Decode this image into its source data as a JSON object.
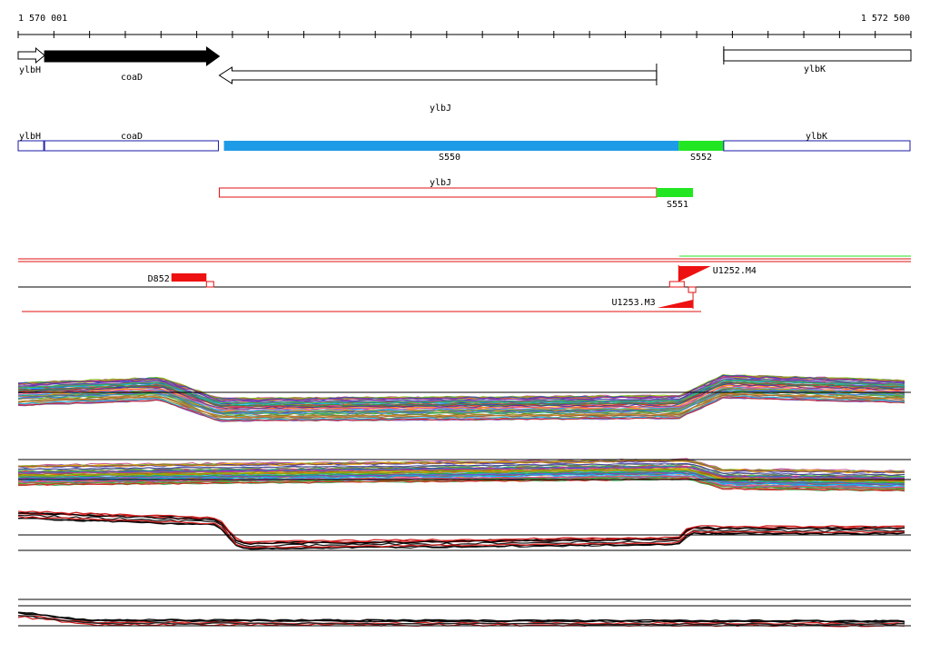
{
  "ruler": {
    "start_label": "1 570 001",
    "end_label": "1 572 500",
    "start_bp": 1570001,
    "end_bp": 1572500
  },
  "colors": {
    "segment_blue": "#1e9be6",
    "segment_green": "#22e622",
    "outline_blue": "#1a1aa6",
    "outline_red": "#e01010",
    "feature_red": "#ee1111",
    "black": "#000000"
  },
  "genes": [
    {
      "name": "ylbH",
      "start": 1570001,
      "end": 1570075,
      "strand": "+",
      "fill": "white"
    },
    {
      "name": "coaD",
      "start": 1570075,
      "end": 1570564,
      "strand": "+",
      "fill": "black"
    },
    {
      "name": "ylbJ",
      "start": 1570564,
      "end": 1571788,
      "strand": "-",
      "fill": "white"
    },
    {
      "name": "ylbK",
      "start": 1571976,
      "end": 1572500,
      "strand": "+",
      "fill": "white"
    }
  ],
  "segments": [
    {
      "label": "ylbH",
      "type": "outline",
      "start": 1570001,
      "end": 1570075
    },
    {
      "label": "coaD",
      "type": "outline",
      "start": 1570075,
      "end": 1570564
    },
    {
      "label": "S550",
      "type": "filled",
      "color": "blue",
      "start": 1570577,
      "end": 1571850
    },
    {
      "label": "S552",
      "type": "filled",
      "color": "green",
      "start": 1571850,
      "end": 1571976
    },
    {
      "label": "ylbK",
      "type": "outline",
      "start": 1571976,
      "end": 1572500
    }
  ],
  "segments2": [
    {
      "label": "ylbJ",
      "type": "outline-red",
      "start": 1570564,
      "end": 1571788
    },
    {
      "label": "S551",
      "type": "filled",
      "color": "green",
      "start": 1571788,
      "end": 1571890
    }
  ],
  "features": [
    {
      "label": "D852",
      "start": 1570430,
      "end": 1570528,
      "kind": "block"
    },
    {
      "label": "U1252.M4",
      "start": 1571850,
      "end": 1571940,
      "kind": "flag-up"
    },
    {
      "label": "U1253.M3",
      "start": 1571790,
      "end": 1571890,
      "kind": "flag-down"
    }
  ],
  "chart_data": {
    "type": "line",
    "x_range": [
      1570001,
      1572500
    ],
    "x_unit": "bp",
    "track_labels": {
      "gene_labels": [
        "ylbH",
        "coaD",
        "ylbJ",
        "ylbK"
      ],
      "segment_labels": [
        "ylbH",
        "coaD",
        "S550",
        "S552",
        "ylbK"
      ],
      "segment2_labels": [
        "ylbJ",
        "S551"
      ],
      "feature_labels": [
        "D852",
        "U1252.M4",
        "U1253.M3"
      ]
    },
    "series_profiles": [
      {
        "panel": 1,
        "breakpoints": [
          1570001,
          1570400,
          1570564,
          1571850,
          1571976,
          1572500
        ],
        "levels": [
          0.5,
          0.6,
          0.2,
          0.25,
          0.65,
          0.55
        ]
      },
      {
        "panel": 2,
        "breakpoints": [
          1570001,
          1571880,
          1571976,
          1572500
        ],
        "levels": [
          0.4,
          0.55,
          0.3,
          0.25
        ]
      },
      {
        "panel": 3,
        "breakpoints": [
          1570001,
          1570560,
          1570620,
          1571850,
          1571880,
          1572500
        ],
        "levels": [
          0.9,
          0.75,
          0.2,
          0.3,
          0.55,
          0.55
        ]
      },
      {
        "panel": 4,
        "breakpoints": [
          1570001,
          1570200,
          1572500
        ],
        "levels": [
          0.8,
          0.4,
          0.35
        ]
      }
    ]
  }
}
